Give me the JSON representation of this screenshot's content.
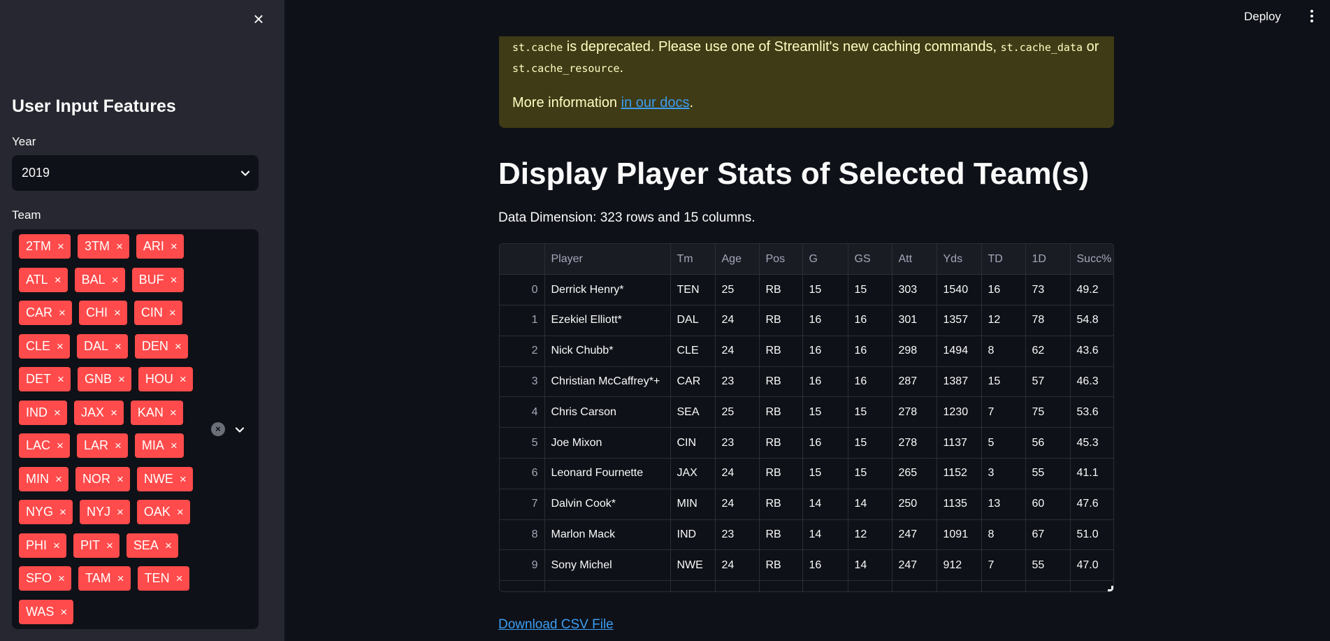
{
  "sidebar": {
    "title": "User Input Features",
    "year_label": "Year",
    "year_value": "2019",
    "team_label": "Team",
    "teams": [
      "2TM",
      "3TM",
      "ARI",
      "ATL",
      "BAL",
      "BUF",
      "CAR",
      "CHI",
      "CIN",
      "CLE",
      "DAL",
      "DEN",
      "DET",
      "GNB",
      "HOU",
      "IND",
      "JAX",
      "KAN",
      "LAC",
      "LAR",
      "MIA",
      "MIN",
      "NOR",
      "NWE",
      "NYG",
      "NYJ",
      "OAK",
      "PHI",
      "PIT",
      "SEA",
      "SFO",
      "TAM",
      "TEN",
      "WAS"
    ],
    "close_icon": "×",
    "tag_remove_icon": "×",
    "clear_icon": "×"
  },
  "header": {
    "deploy_label": "Deploy"
  },
  "warning": {
    "code1": "st.cache",
    "text1": " is deprecated. Please use one of Streamlit's new caching commands, ",
    "code2": "st.cache_data",
    "text2": " or",
    "code3": "st.cache_resource",
    "text3": ".",
    "more_prefix": "More information ",
    "link_text": "in our docs",
    "more_suffix": "."
  },
  "main": {
    "title": "Display Player Stats of Selected Team(s)",
    "dimension": "Data Dimension: 323 rows and 15 columns.",
    "download_label": "Download CSV File"
  },
  "table": {
    "columns": [
      "",
      "Player",
      "Tm",
      "Age",
      "Pos",
      "G",
      "GS",
      "Att",
      "Yds",
      "TD",
      "1D",
      "Succ%"
    ],
    "rows": [
      [
        "0",
        "Derrick Henry*",
        "TEN",
        "25",
        "RB",
        "15",
        "15",
        "303",
        "1540",
        "16",
        "73",
        "49.2"
      ],
      [
        "1",
        "Ezekiel Elliott*",
        "DAL",
        "24",
        "RB",
        "16",
        "16",
        "301",
        "1357",
        "12",
        "78",
        "54.8"
      ],
      [
        "2",
        "Nick Chubb*",
        "CLE",
        "24",
        "RB",
        "16",
        "16",
        "298",
        "1494",
        "8",
        "62",
        "43.6"
      ],
      [
        "3",
        "Christian McCaffrey*+",
        "CAR",
        "23",
        "RB",
        "16",
        "16",
        "287",
        "1387",
        "15",
        "57",
        "46.3"
      ],
      [
        "4",
        "Chris Carson",
        "SEA",
        "25",
        "RB",
        "15",
        "15",
        "278",
        "1230",
        "7",
        "75",
        "53.6"
      ],
      [
        "5",
        "Joe Mixon",
        "CIN",
        "23",
        "RB",
        "16",
        "15",
        "278",
        "1137",
        "5",
        "56",
        "45.3"
      ],
      [
        "6",
        "Leonard Fournette",
        "JAX",
        "24",
        "RB",
        "15",
        "15",
        "265",
        "1152",
        "3",
        "55",
        "41.1"
      ],
      [
        "7",
        "Dalvin Cook*",
        "MIN",
        "24",
        "RB",
        "14",
        "14",
        "250",
        "1135",
        "13",
        "60",
        "47.6"
      ],
      [
        "8",
        "Marlon Mack",
        "IND",
        "23",
        "RB",
        "14",
        "12",
        "247",
        "1091",
        "8",
        "67",
        "51.0"
      ],
      [
        "9",
        "Sony Michel",
        "NWE",
        "24",
        "RB",
        "16",
        "14",
        "247",
        "912",
        "7",
        "55",
        "47.0"
      ]
    ]
  },
  "colors": {
    "tag": "#ff4b4b",
    "sidebar_bg": "#262730",
    "main_bg": "#0e1117",
    "warning_bg": "#3e3b16",
    "link": "#3d9df3"
  }
}
